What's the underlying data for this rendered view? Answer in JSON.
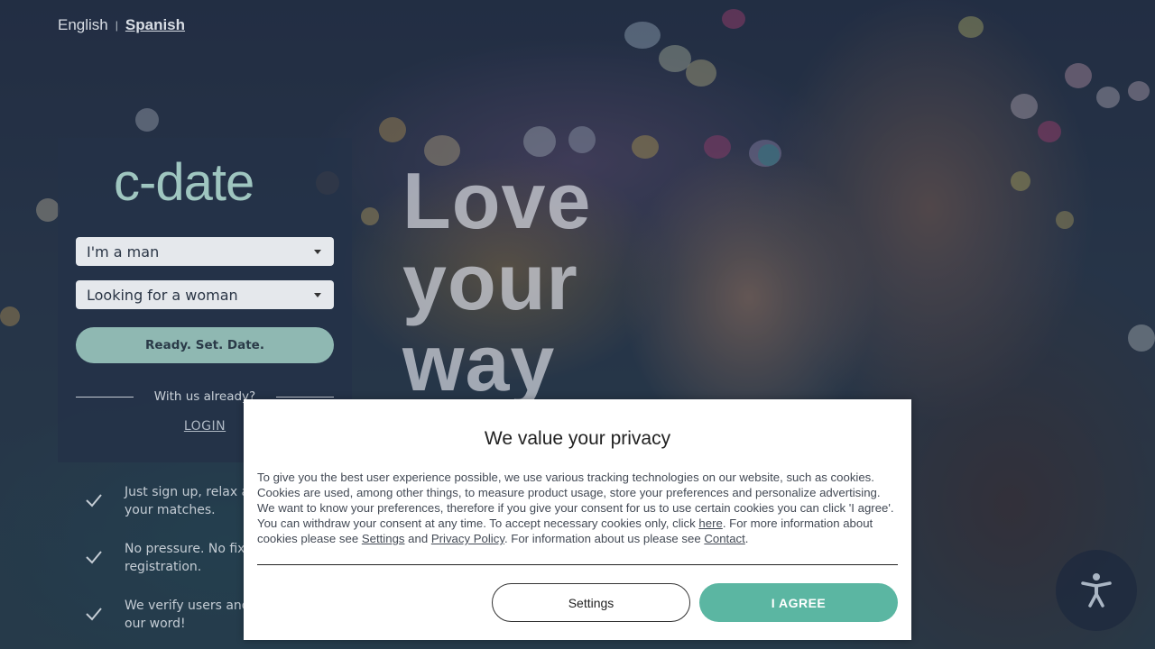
{
  "language": {
    "options": [
      "English",
      "Spanish"
    ],
    "separator": "|",
    "active": "Spanish"
  },
  "brand": {
    "logo": "c-date"
  },
  "form": {
    "gender_select": "I'm a man",
    "seeking_select": "Looking for a woman",
    "cta_label": "Ready. Set. Date.",
    "with_us_text": "With us already?",
    "login_label": "LOGIN"
  },
  "features": [
    {
      "line1": "Just sign up, relax a",
      "line2": "your matches."
    },
    {
      "line1": "No pressure. No fix",
      "line2": "registration."
    },
    {
      "line1": "We verify users and",
      "line2": "our word!"
    }
  ],
  "hero": {
    "lines": [
      "Love",
      "your",
      "way"
    ]
  },
  "cookie": {
    "title": "We value your privacy",
    "text_1": "To give you the best user experience possible, we use various tracking technologies on our website, such as cookies. Cookies are used, among other things, to measure product usage, store your preferences and personalize advertising. We want to know your preferences, therefore if you give your consent for us to use certain cookies you can click 'I agree'. You can withdraw your consent at any time. To accept necessary cookies only, click ",
    "link_here": "here",
    "text_2": ". For more information about cookies please see ",
    "link_settings": "Settings",
    "text_3": " and ",
    "link_privacy": "Privacy Policy",
    "text_4": ". For information about us please see ",
    "link_contact": "Contact",
    "text_5": ".",
    "settings_button": "Settings",
    "agree_button": "I AGREE"
  },
  "colors": {
    "accent": "#5bb6a2",
    "logo": "#9fc6c0",
    "panel": "#243248"
  },
  "icons": {
    "feature_check": "check-icon",
    "accessibility": "accessibility-icon",
    "dropdown": "caret-down-icon"
  }
}
